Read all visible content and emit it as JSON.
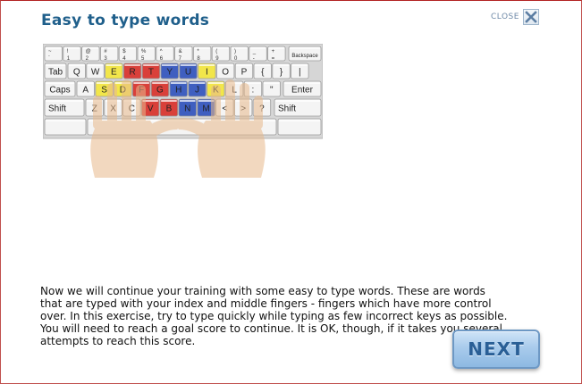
{
  "dialog": {
    "title": "Easy to type words",
    "close_label": "CLOSE",
    "close_icon": "close-x-icon",
    "body_text": "Now we will continue your training with some easy to type words. These are words that are typed with your index and middle fingers - fingers which have more control over. In this exercise, try to type quickly while typing as few incorrect keys as possible. You will need to reach a goal score to continue. It is OK, though, if it takes you several attempts to reach this score.",
    "next_label": "NEXT"
  },
  "keyboard": {
    "row0": [
      [
        "~",
        "`"
      ],
      [
        "!",
        "1"
      ],
      [
        "@",
        "2"
      ],
      [
        "#",
        "3"
      ],
      [
        "$",
        "4"
      ],
      [
        "%",
        "5"
      ],
      [
        "^",
        "6"
      ],
      [
        "&",
        "7"
      ],
      [
        "*",
        "8"
      ],
      [
        "(",
        "9"
      ],
      [
        ")",
        "0"
      ],
      [
        "_",
        "-"
      ],
      [
        "+",
        "="
      ]
    ],
    "backspace": "Backspace",
    "tab": "Tab",
    "row1": [
      "Q",
      "W",
      "E",
      "R",
      "T",
      "Y",
      "U",
      "I",
      "O",
      "P",
      "{",
      "}",
      "|"
    ],
    "caps": "Caps",
    "row2": [
      "A",
      "S",
      "D",
      "F",
      "G",
      "H",
      "J",
      "K",
      "L",
      ":",
      "\""
    ],
    "enter": "Enter",
    "shift": "Shift",
    "row3": [
      "Z",
      "X",
      "C",
      "V",
      "B",
      "N",
      "M",
      "<",
      ">",
      "?"
    ],
    "highlight_colors": {
      "yellow": "#f2e64a",
      "red": "#d9403a",
      "blue": "#3f5fc0",
      "hands": "#e8b98c"
    }
  }
}
